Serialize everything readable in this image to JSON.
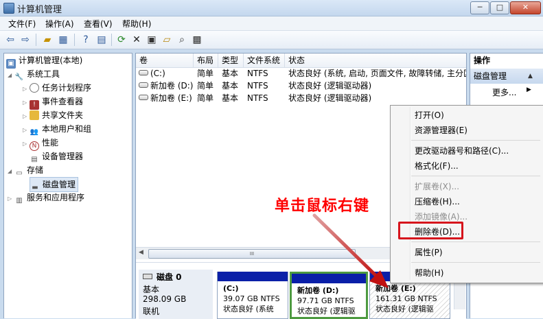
{
  "window": {
    "title": "计算机管理",
    "controls": [
      "─",
      "□",
      "✕"
    ]
  },
  "menu": [
    "文件(F)",
    "操作(A)",
    "查看(V)",
    "帮助(H)"
  ],
  "toolbar_icons": [
    "back-icon",
    "forward-icon",
    "up-folder-icon",
    "show-tree-icon",
    "help-icon",
    "console-icon",
    "refresh-icon",
    "delete-icon",
    "properties-icon",
    "open-icon",
    "search-icon",
    "wizard-icon"
  ],
  "tree": {
    "root": "计算机管理(本地)",
    "system_tools": "系统工具",
    "task_scheduler": "任务计划程序",
    "event_viewer": "事件查看器",
    "shared_folders": "共享文件夹",
    "local_users": "本地用户和组",
    "performance": "性能",
    "device_manager": "设备管理器",
    "storage": "存储",
    "disk_management": "磁盘管理",
    "services": "服务和应用程序"
  },
  "volume_table": {
    "columns": [
      "卷",
      "布局",
      "类型",
      "文件系统",
      "状态"
    ],
    "rows": [
      {
        "volume": "(C:)",
        "layout": "简单",
        "type": "基本",
        "fs": "NTFS",
        "status": "状态良好 (系统, 启动, 页面文件, 故障转储, 主分区"
      },
      {
        "volume": "新加卷 (D:)",
        "layout": "简单",
        "type": "基本",
        "fs": "NTFS",
        "status": "状态良好 (逻辑驱动器)"
      },
      {
        "volume": "新加卷 (E:)",
        "layout": "简单",
        "type": "基本",
        "fs": "NTFS",
        "status": "状态良好 (逻辑驱动器)"
      }
    ]
  },
  "disk": {
    "name": "磁盘 0",
    "type": "基本",
    "size": "298.09 GB",
    "status": "联机",
    "partitions": [
      {
        "name": "(C:)",
        "size": "39.07 GB NTFS",
        "status": "状态良好 (系统"
      },
      {
        "name": "新加卷  (D:)",
        "size": "97.71 GB NTFS",
        "status": "状态良好 (逻辑驱"
      },
      {
        "name": "新加卷  (E:)",
        "size": "161.31 GB NTFS",
        "status": "状态良好 (逻辑驱"
      }
    ]
  },
  "actions": {
    "title": "操作",
    "group": "磁盘管理",
    "more": "更多..."
  },
  "context_menu": [
    {
      "label": "打开(O)",
      "enabled": true
    },
    {
      "label": "资源管理器(E)",
      "enabled": true
    },
    {
      "label": "更改驱动器号和路径(C)...",
      "enabled": true
    },
    {
      "label": "格式化(F)...",
      "enabled": true
    },
    {
      "label": "扩展卷(X)...",
      "enabled": false
    },
    {
      "label": "压缩卷(H)...",
      "enabled": true
    },
    {
      "label": "添加镜像(A)...",
      "enabled": false
    },
    {
      "label": "删除卷(D)...",
      "enabled": true
    },
    {
      "label": "属性(P)",
      "enabled": true
    },
    {
      "label": "帮助(H)",
      "enabled": true
    }
  ],
  "scrollbar_grip": "III",
  "annotation": "单击鼠标右键",
  "colors": {
    "annotation": "#ff0000",
    "highlight_box": "#d6141c",
    "partition_bar": "#0a1fa8",
    "selected_partition": "#4d9a40"
  }
}
